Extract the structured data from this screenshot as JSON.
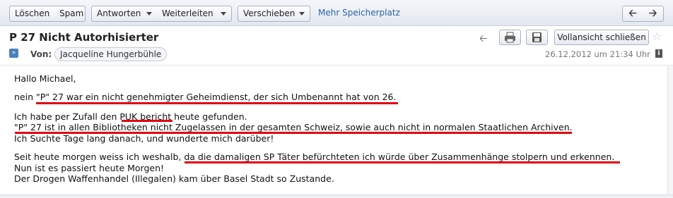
{
  "toolbar": {
    "delete_label": "Löschen",
    "spam_label": "Spam",
    "reply_label": "Antworten",
    "forward_label": "Weiterleiten",
    "move_label": "Verschieben",
    "storage_link": "Mehr Speicherplatz",
    "prev_icon": "left-arrow-icon",
    "next_icon": "right-arrow-icon"
  },
  "header": {
    "subject": "P 27 Nicht Autorhisierter",
    "from_label": "Von:",
    "from_name": "Jacqueline Hungerbühle",
    "date": "26.12.2012 um 21:34 Uhr",
    "fullview_label": "Vollansicht schließen",
    "icons": [
      "back-arrow-icon",
      "printer-icon",
      "save-icon",
      "star-icon",
      "info-icon",
      "expand-icon"
    ]
  },
  "body": {
    "greeting": "Hallo Michael,",
    "line1": "nein \"P\" 27 war ein nicht genehmigter Geheimdienst, der sich Umbenannt hat von 26.",
    "line2": "Ich habe per Zufall den PUK bericht heute gefunden.",
    "line3": "\"P\" 27 ist in allen Bibliotheken nicht Zugelassen in der gesamten Schweiz, sowie auch nicht in normalen Staatlichen Archiven.",
    "line4": "Ich Suchte Tage lang danach, und wunderte mich darüber!",
    "line5": "Seit heute morgen weiss ich weshalb, da die damaligen SP Täter befürchteten ich würde über Zusammenhänge stolpern und erkennen.",
    "line6": "Nun ist es passiert heute Morgen!",
    "line7": "Der Drogen Waffenhandel (Illegalen) kam über Basel Stadt so Zustande."
  },
  "colors": {
    "underline": "#e3000f",
    "link": "#2a64a8"
  }
}
